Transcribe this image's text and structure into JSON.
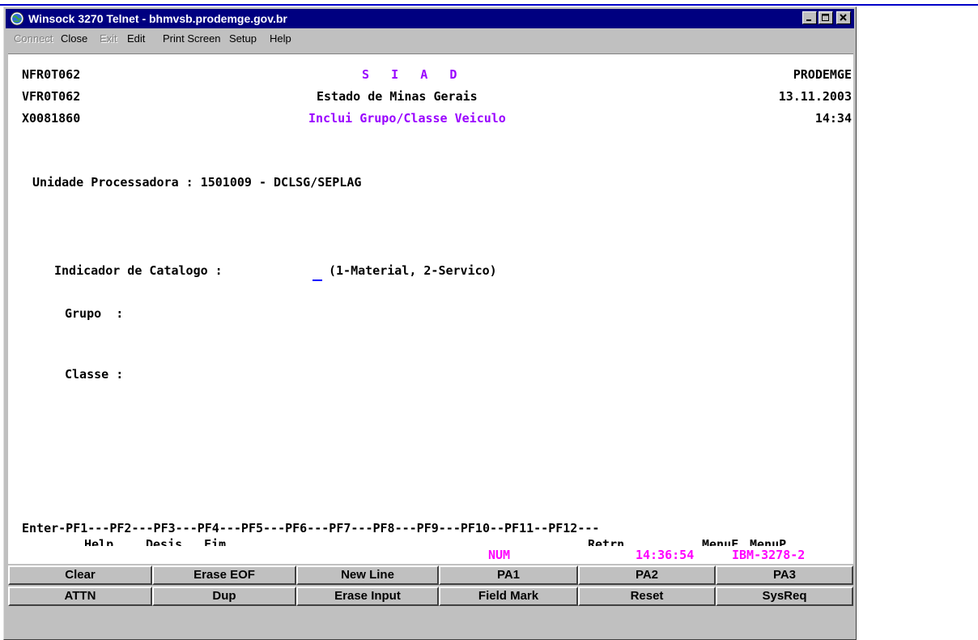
{
  "window": {
    "title": "Winsock 3270 Telnet - bhmvsb.prodemge.gov.br"
  },
  "menu": {
    "items": [
      {
        "label": "Connect",
        "enabled": false
      },
      {
        "label": "Close",
        "enabled": true
      },
      {
        "label": "Exit",
        "enabled": false
      },
      {
        "label": "Edit",
        "enabled": true
      },
      {
        "label": "Print Screen",
        "enabled": true
      },
      {
        "label": "Setup",
        "enabled": true
      },
      {
        "label": "Help",
        "enabled": true
      }
    ]
  },
  "screen": {
    "header": {
      "program1": "NFR0T062",
      "program2": "VFR0T062",
      "user": "X0081860",
      "system": "S   I   A   D",
      "state": "Estado de Minas Gerais",
      "function": "Inclui Grupo/Classe Veiculo",
      "company": "PRODEMGE",
      "date": "13.11.2003",
      "time": "14:34"
    },
    "unit_line": "Unidade Processadora : 1501009 - DCLSG/SEPLAG",
    "catalog_label": "Indicador de Catalogo :",
    "catalog_value": "",
    "catalog_hint": "(1-Material, 2-Servico)",
    "grupo_label": "Grupo  :",
    "classe_label": "Classe :",
    "pf_line": "Enter-PF1---PF2---PF3---PF4---PF5---PF6---PF7---PF8---PF9---PF10--PF11--PF12---",
    "pf_help": "Help",
    "pf_desis": "Desis",
    "pf_fim": "Fim",
    "pf_retrn": "Retrn",
    "pf_menuf": "MenuF",
    "pf_menup": "MenuP"
  },
  "status": {
    "num": "NUM",
    "clock": "14:36:54",
    "terminal_type": "IBM-3278-2"
  },
  "keypad": {
    "row1": [
      "Clear",
      "Erase EOF",
      "New Line",
      "PA1",
      "PA2",
      "PA3"
    ],
    "row2": [
      "ATTN",
      "Dup",
      "Erase Input",
      "Field Mark",
      "Reset",
      "SysReq"
    ]
  },
  "colors": {
    "titlebar": "#000080",
    "field_highlight": "#9900ff",
    "status_text": "#ff00ff",
    "cursor": "#0000ff"
  },
  "icons": {
    "app": "globe-icon",
    "minimize": "minimize-icon",
    "maximize": "maximize-icon",
    "close": "close-icon"
  }
}
